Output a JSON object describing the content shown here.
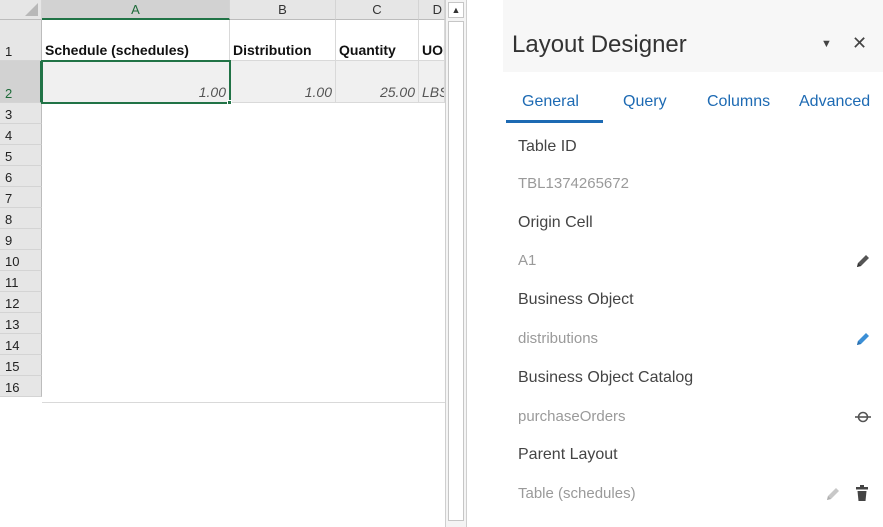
{
  "sheet": {
    "columns": [
      "A",
      "B",
      "C",
      "D"
    ],
    "rows": [
      "1",
      "2",
      "3",
      "4",
      "5",
      "6",
      "7",
      "8",
      "9",
      "10",
      "11",
      "12",
      "13",
      "14",
      "15",
      "16"
    ],
    "header_row": [
      "Schedule (schedules)",
      "Distribution",
      "Quantity",
      "UOM"
    ],
    "data_row": [
      "1.00",
      "1.00",
      "25.00",
      "LBS"
    ],
    "active_cell": "A2"
  },
  "designer": {
    "title": "Layout Designer",
    "tabs": [
      "General",
      "Query",
      "Columns",
      "Advanced"
    ],
    "active_tab": "General",
    "fields": {
      "table_id": {
        "label": "Table ID",
        "value": "TBL1374265672"
      },
      "origin_cell": {
        "label": "Origin Cell",
        "value": "A1"
      },
      "business_object": {
        "label": "Business Object",
        "value": "distributions"
      },
      "catalog": {
        "label": "Business Object Catalog",
        "value": "purchaseOrders"
      },
      "parent_layout": {
        "label": "Parent Layout",
        "value": "Table (schedules)"
      }
    },
    "icons": {
      "origin_cell_edit": "pencil-icon",
      "business_object_edit": "pencil-icon",
      "catalog_select": "target-icon",
      "parent_layout_edit": "pencil-icon",
      "parent_layout_delete": "trash-icon",
      "pane_menu": "chevron-down-icon",
      "pane_close": "close-icon"
    }
  },
  "colors": {
    "excel_green": "#217346",
    "tab_blue": "#1d6ab3",
    "pencil_blue": "#3b8fd6",
    "pencil_dark": "#555555",
    "pencil_light": "#c8c8c8"
  }
}
